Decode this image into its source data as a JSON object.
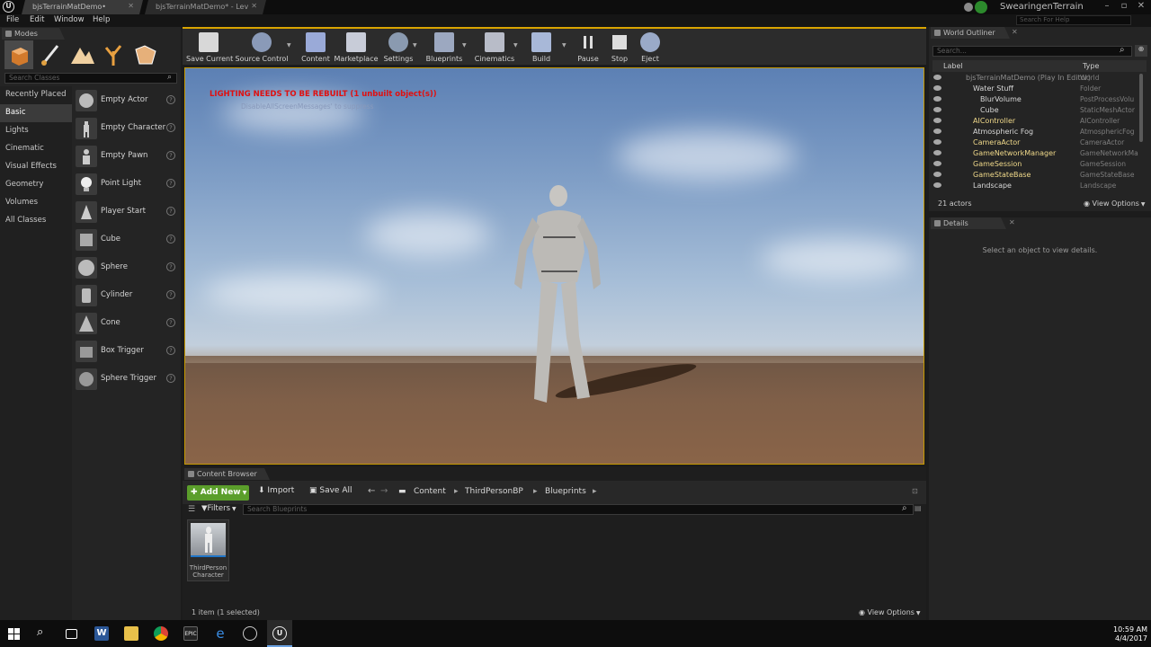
{
  "titlebar": {
    "tabs": [
      "bjsTerrainMatDemo•",
      "bjsTerrainMatDemo* - Lev"
    ],
    "project_name": "SwearingenTerrain",
    "help_search_placeholder": "Search For Help"
  },
  "menu": [
    "File",
    "Edit",
    "Window",
    "Help"
  ],
  "modes": {
    "tab_label": "Modes",
    "search_placeholder": "Search Classes",
    "mode_icons": [
      "place-mode-icon",
      "paint-mode-icon",
      "landscape-mode-icon",
      "foliage-mode-icon",
      "geometry-edit-mode-icon"
    ],
    "categories": [
      "Recently Placed",
      "Basic",
      "Lights",
      "Cinematic",
      "Visual Effects",
      "Geometry",
      "Volumes",
      "All Classes"
    ],
    "selected_category": "Basic",
    "items": [
      "Empty Actor",
      "Empty Character",
      "Empty Pawn",
      "Point Light",
      "Player Start",
      "Cube",
      "Sphere",
      "Cylinder",
      "Cone",
      "Box Trigger",
      "Sphere Trigger"
    ]
  },
  "toolbar": {
    "buttons": [
      "Save Current",
      "Source Control",
      "Content",
      "Marketplace",
      "Settings",
      "Blueprints",
      "Cinematics",
      "Build",
      "Pause",
      "Stop",
      "Eject"
    ]
  },
  "viewport": {
    "warning": "LIGHTING NEEDS TO BE REBUILT (1 unbuilt object(s))",
    "warning_sub": "DisableAllScreenMessages' to suppress"
  },
  "content_browser": {
    "tab_label": "Content Browser",
    "add_new": "Add New",
    "import": "Import",
    "save_all": "Save All",
    "breadcrumb": [
      "Content",
      "ThirdPersonBP",
      "Blueprints"
    ],
    "filters": "Filters",
    "search_placeholder": "Search Blueprints",
    "asset_label": "ThirdPerson Character",
    "status": "1 item (1 selected)",
    "view_options": "View Options"
  },
  "outliner": {
    "tab_label": "World Outliner",
    "search_placeholder": "Search...",
    "col_label": "Label",
    "col_type": "Type",
    "rows": [
      {
        "label": "bjsTerrainMatDemo (Play In Editor)",
        "type": "World"
      },
      {
        "label": "Water Stuff",
        "type": "Folder"
      },
      {
        "label": "BlurVolume",
        "type": "PostProcessVolu"
      },
      {
        "label": "Cube",
        "type": "StaticMeshActor"
      },
      {
        "label": "AIController",
        "type": "AIController"
      },
      {
        "label": "Atmospheric Fog",
        "type": "AtmosphericFog"
      },
      {
        "label": "CameraActor",
        "type": "CameraActor"
      },
      {
        "label": "GameNetworkManager",
        "type": "GameNetworkMa"
      },
      {
        "label": "GameSession",
        "type": "GameSession"
      },
      {
        "label": "GameStateBase",
        "type": "GameStateBase"
      },
      {
        "label": "Landscape",
        "type": "Landscape"
      }
    ],
    "actor_count": "21 actors",
    "view_options": "View Options"
  },
  "details": {
    "tab_label": "Details",
    "empty_text": "Select an object to view details."
  },
  "taskbar": {
    "time": "10:59 AM",
    "date": "4/4/2017",
    "icons": [
      "windows-start-icon",
      "search-icon",
      "task-view-icon",
      "word-icon",
      "file-explorer-icon",
      "chrome-icon",
      "epic-launcher-icon",
      "edge-icon",
      "chromium-icon",
      "unreal-editor-icon"
    ]
  }
}
